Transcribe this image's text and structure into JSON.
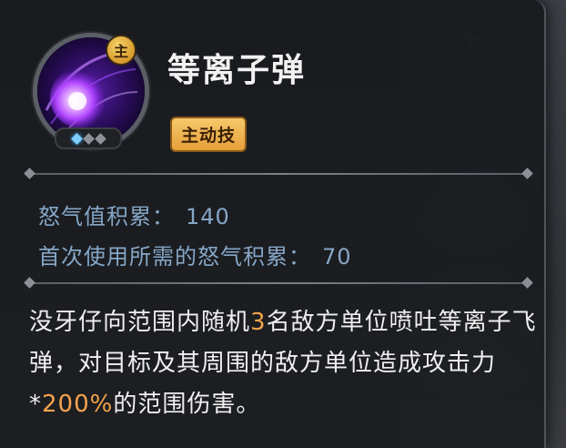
{
  "skill": {
    "main_badge": "主",
    "title": "等离子弹",
    "type_tag": "主动技",
    "level": {
      "current": 1,
      "max": 3
    },
    "icon": "purple-plasma-orb-icon"
  },
  "stats": {
    "rage_accumulation_label": "怒气值积累：",
    "rage_accumulation_value": "140",
    "first_use_rage_label": "首次使用所需的怒气积累：",
    "first_use_rage_value": "70"
  },
  "description": {
    "part1": "没牙仔向范围内随机",
    "num_targets": "3",
    "part2": "名敌方单位喷吐等离子飞弹，对目标及其周围的敌方单位造成攻击力*",
    "percent": "200%",
    "part3": "的范围伤害。"
  },
  "colors": {
    "stat_text": "#86a6c6",
    "highlight": "#f5a34a",
    "tag_bg": "#e5a13a"
  }
}
